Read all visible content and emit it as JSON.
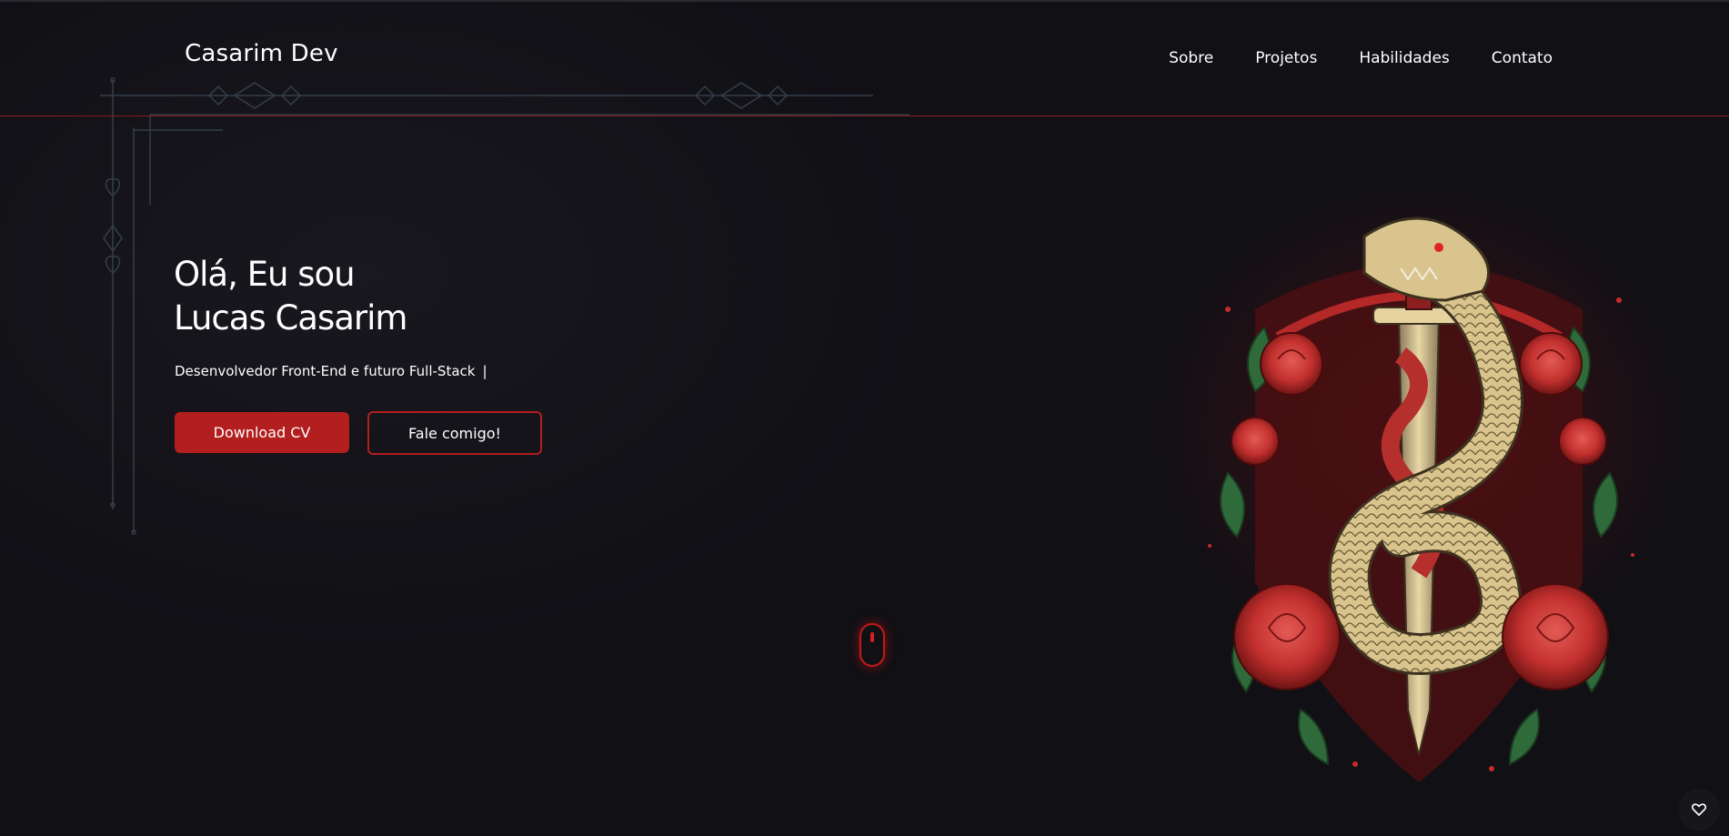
{
  "header": {
    "brand": "Casarim Dev",
    "nav": [
      {
        "label": "Sobre"
      },
      {
        "label": "Projetos"
      },
      {
        "label": "Habilidades"
      },
      {
        "label": "Contato"
      }
    ]
  },
  "hero": {
    "greeting_line1": "Olá, Eu sou",
    "greeting_line2": "Lucas Casarim",
    "subtitle": "Desenvolvedor Front-End e futuro Full-Stack",
    "caret": "|",
    "primary_button": "Download CV",
    "secondary_button": "Fale comigo!"
  },
  "icons": {
    "scroll": "mouse-scroll-icon",
    "fab": "heart-icon"
  },
  "colors": {
    "background": "#111015",
    "accent": "#b31e1e",
    "ornament": "#3b4654"
  }
}
